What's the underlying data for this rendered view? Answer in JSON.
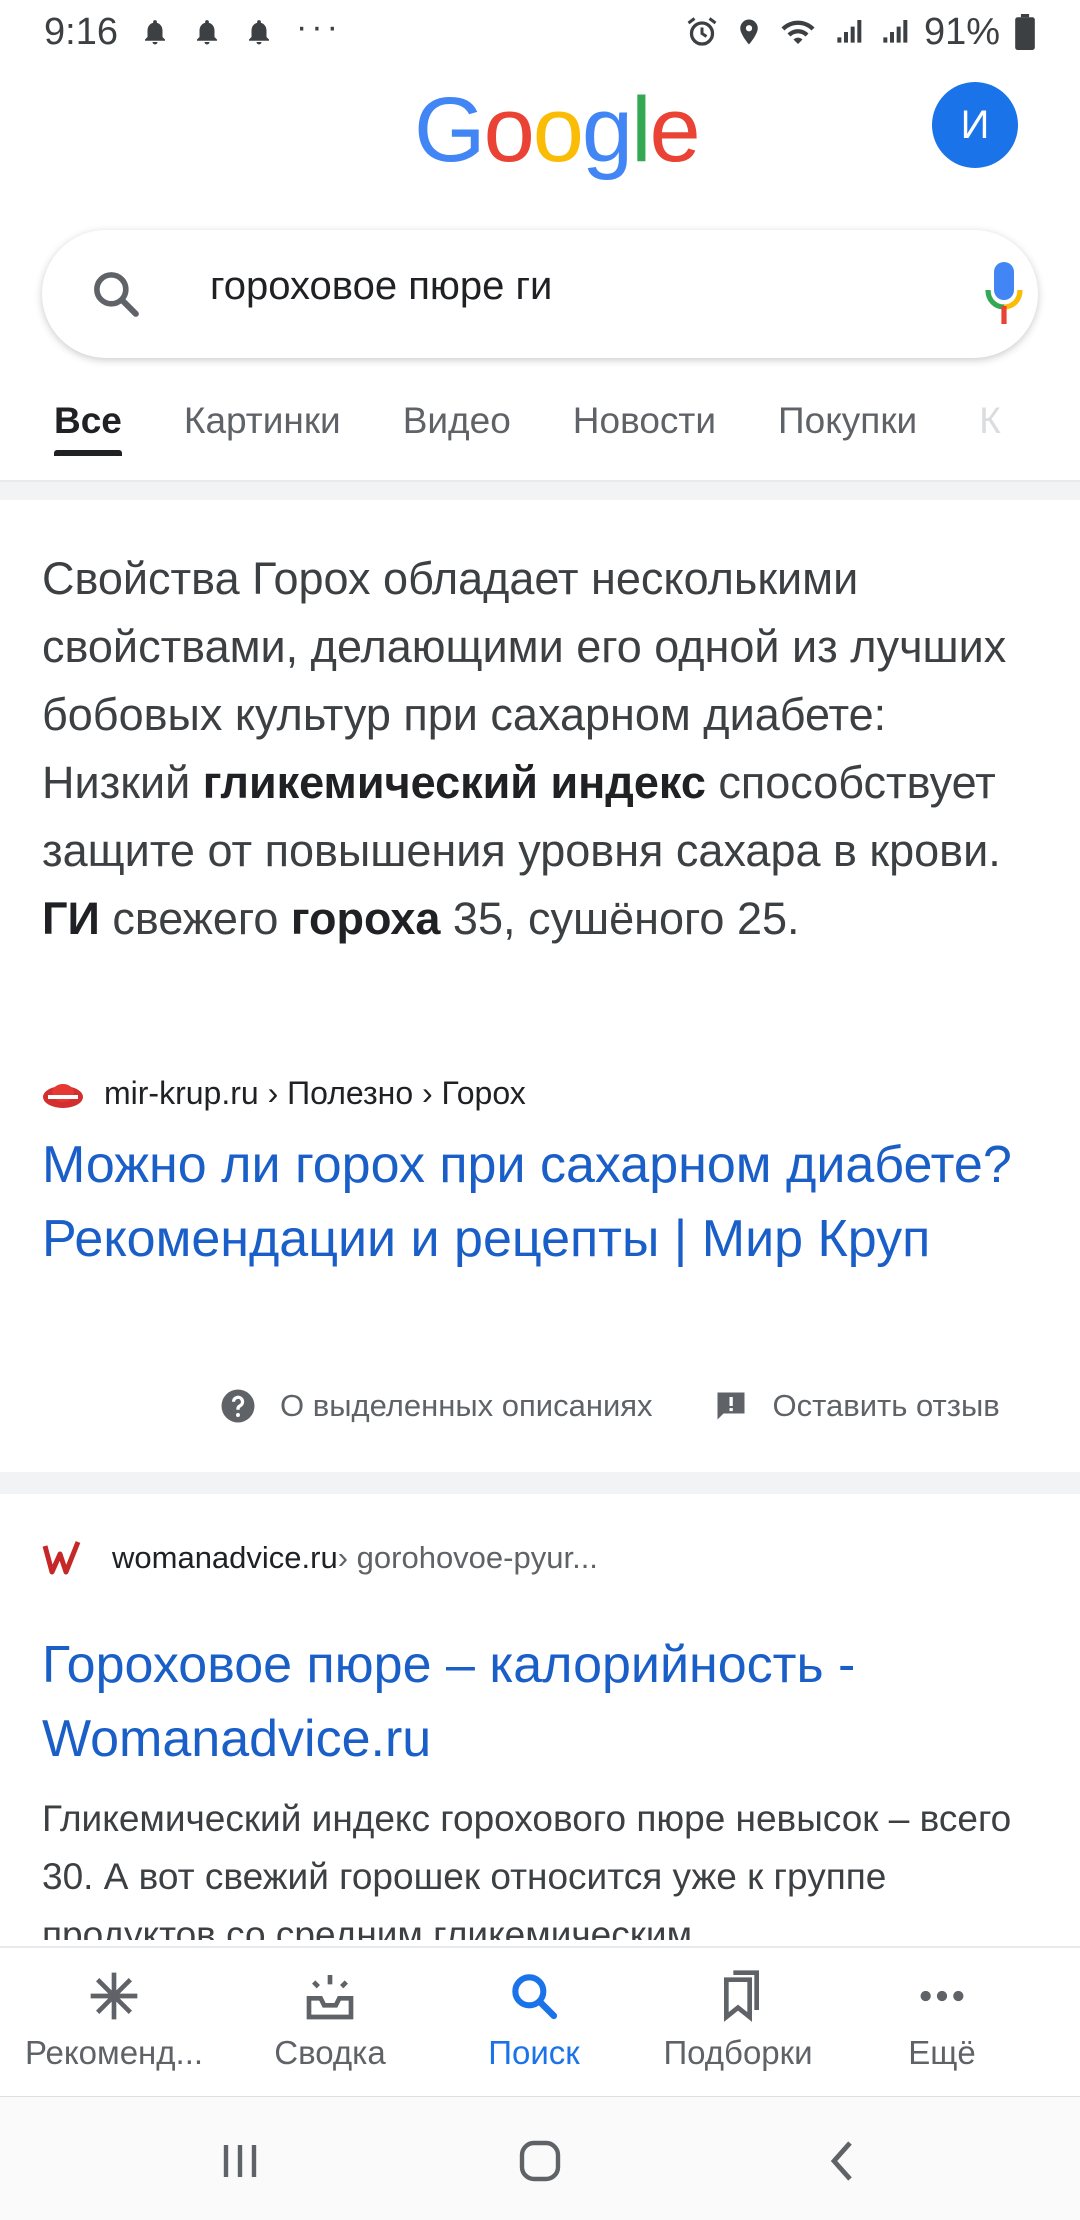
{
  "status_bar": {
    "time": "9:16",
    "dots": "···",
    "battery": "91%"
  },
  "header": {
    "logo": [
      "G",
      "o",
      "o",
      "g",
      "l",
      "e"
    ],
    "logo_colors": [
      "#4285F4",
      "#EA4335",
      "#FBBC05",
      "#4285F4",
      "#34A853",
      "#EA4335"
    ],
    "avatar_letter": "И"
  },
  "search": {
    "query": "гороховое пюре ги"
  },
  "tabs": [
    "Все",
    "Картинки",
    "Видео",
    "Новости",
    "Покупки",
    "К"
  ],
  "snippet": {
    "p1": "Свойства Горох обладает несколькими свойствами, делающими его одной из лучших бобовых культур при сахарном диабете: Низкий ",
    "b1": "гликемический индекс",
    "p2": " способствует защите от повышения уровня сахара в крови. ",
    "b2": "ГИ",
    "p3": " свежего ",
    "b3": "гороха",
    "p4": " 35, сушёного 25."
  },
  "result1": {
    "source": "mir-krup.ru › Полезно › Горох",
    "title": "Можно ли горох при сахарном диабете? Рекомендации и рецепты | Мир Круп"
  },
  "feedback": {
    "about": "О выделенных описаниях",
    "leave": "Оставить отзыв"
  },
  "result2": {
    "domain": "womanadvice.ru",
    "crumb": " › gorohovoe-pyur...",
    "title": "Гороховое пюре – калорийность - Womanadvice.ru",
    "description": "Гликемический индекс горохового пюре невысок – всего 30. А вот свежий горошек относится уже к группе продуктов со средним гликемическим"
  },
  "bottom_nav": {
    "items": [
      "Рекоменд...",
      "Сводка",
      "Поиск",
      "Подборки",
      "Ещё"
    ],
    "active": "Поиск"
  },
  "colors": {
    "link": "#1a5ec8",
    "active_nav": "#1a73e8"
  }
}
